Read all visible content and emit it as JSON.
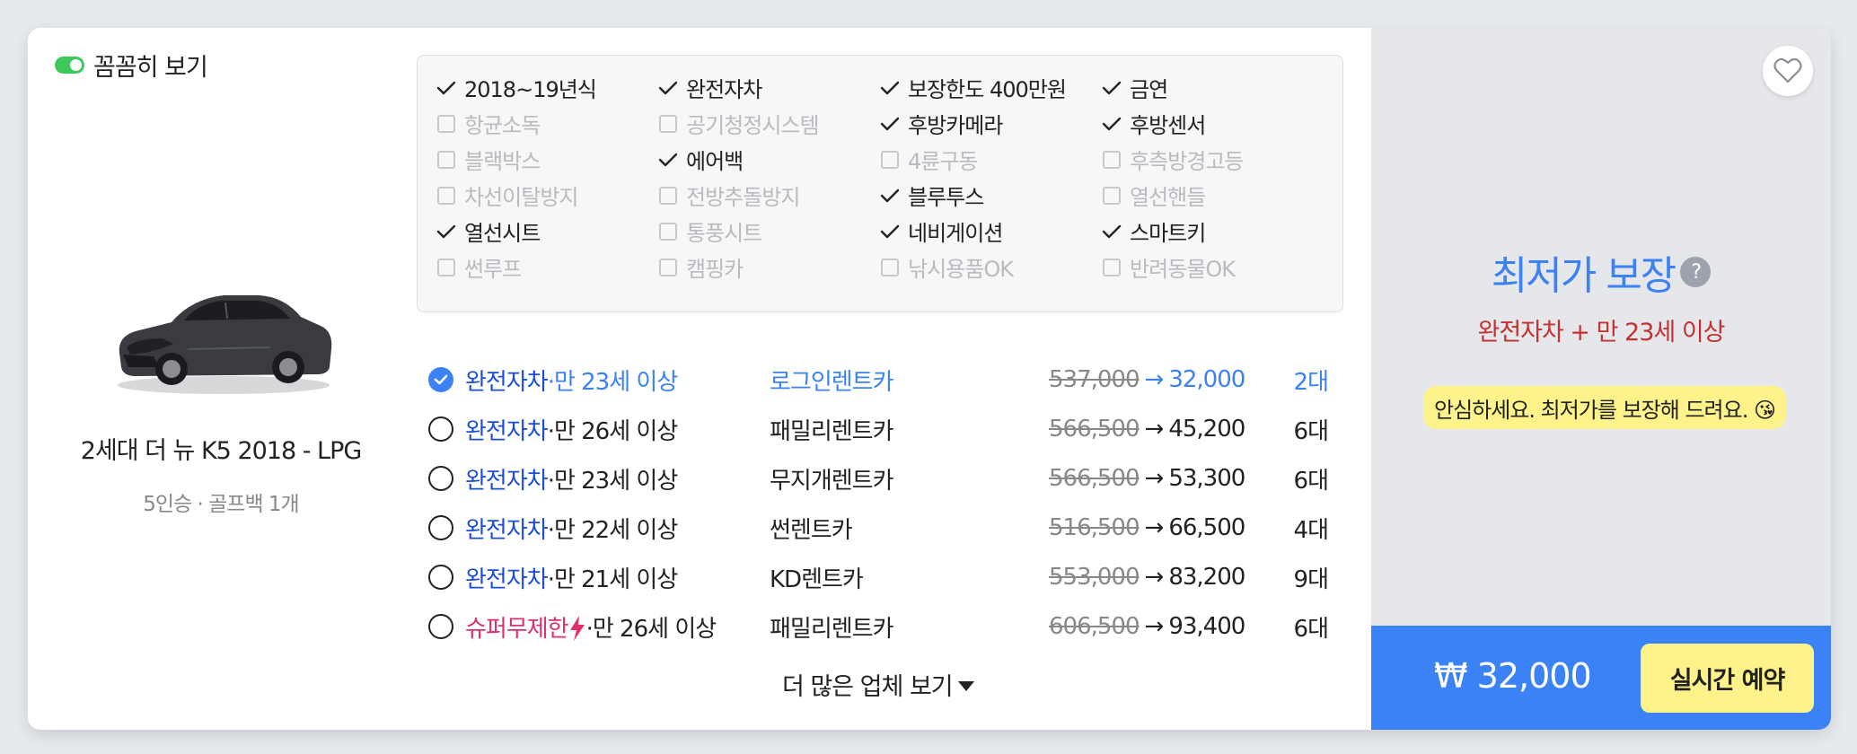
{
  "toggle": {
    "label": "꼼꼼히 보기",
    "on": true
  },
  "car": {
    "name": "2세대 더 뉴 K5 2018 - LPG",
    "spec": "5인승 · 골프백 1개"
  },
  "options": [
    {
      "label": "2018~19년식",
      "on": true
    },
    {
      "label": "완전자차",
      "on": true
    },
    {
      "label": "보장한도 400만원",
      "on": true
    },
    {
      "label": "금연",
      "on": true
    },
    {
      "label": "항균소독",
      "on": false
    },
    {
      "label": "공기청정시스템",
      "on": false
    },
    {
      "label": "후방카메라",
      "on": true
    },
    {
      "label": "후방센서",
      "on": true
    },
    {
      "label": "블랙박스",
      "on": false
    },
    {
      "label": "에어백",
      "on": true
    },
    {
      "label": "4륜구동",
      "on": false
    },
    {
      "label": "후측방경고등",
      "on": false
    },
    {
      "label": "차선이탈방지",
      "on": false
    },
    {
      "label": "전방추돌방지",
      "on": false
    },
    {
      "label": "블루투스",
      "on": true
    },
    {
      "label": "열선핸들",
      "on": false
    },
    {
      "label": "열선시트",
      "on": true
    },
    {
      "label": "통풍시트",
      "on": false
    },
    {
      "label": "네비게이션",
      "on": true
    },
    {
      "label": "스마트키",
      "on": true
    },
    {
      "label": "썬루프",
      "on": false
    },
    {
      "label": "캠핑카",
      "on": false
    },
    {
      "label": "낚시용품OK",
      "on": false
    },
    {
      "label": "반려동물OK",
      "on": false
    }
  ],
  "offers": [
    {
      "tag": "완전자차",
      "tag_type": "full",
      "age": "·만 23세 이상",
      "company": "로그인렌트카",
      "orig": "537,000",
      "arrow": "→",
      "price": "32,000",
      "count": "2대",
      "selected": true
    },
    {
      "tag": "완전자차",
      "tag_type": "full",
      "age": "·만 26세 이상",
      "company": "패밀리렌트카",
      "orig": "566,500",
      "arrow": "→",
      "price": "45,200",
      "count": "6대",
      "selected": false
    },
    {
      "tag": "완전자차",
      "tag_type": "full",
      "age": "·만 23세 이상",
      "company": "무지개렌트카",
      "orig": "566,500",
      "arrow": "→",
      "price": "53,300",
      "count": "6대",
      "selected": false
    },
    {
      "tag": "완전자차",
      "tag_type": "full",
      "age": "·만 22세 이상",
      "company": "썬렌트카",
      "orig": "516,500",
      "arrow": "→",
      "price": "66,500",
      "count": "4대",
      "selected": false
    },
    {
      "tag": "완전자차",
      "tag_type": "full",
      "age": "·만 21세 이상",
      "company": "KD렌트카",
      "orig": "553,000",
      "arrow": "→",
      "price": "83,200",
      "count": "9대",
      "selected": false
    },
    {
      "tag": "슈퍼무제한",
      "tag_type": "super",
      "age": "·만 26세 이상",
      "company": "패밀리렌트카",
      "orig": "606,500",
      "arrow": "→",
      "price": "93,400",
      "count": "6대",
      "selected": false
    }
  ],
  "more": {
    "label": "더 많은 업체 보기"
  },
  "best": {
    "title": "최저가 보장",
    "help": "?",
    "subtitle": "완전자차 + 만 23세 이상",
    "note": "안심하세요. 최저가를 보장해 드려요. 😘"
  },
  "footer": {
    "total": "₩ 32,000",
    "reserve_label": "실시간 예약"
  },
  "colors": {
    "accent": "#3b82f6",
    "highlight": "#fdf38a",
    "toggle": "#3cc85a",
    "super": "#e0306c",
    "subtitle": "#c53030"
  }
}
